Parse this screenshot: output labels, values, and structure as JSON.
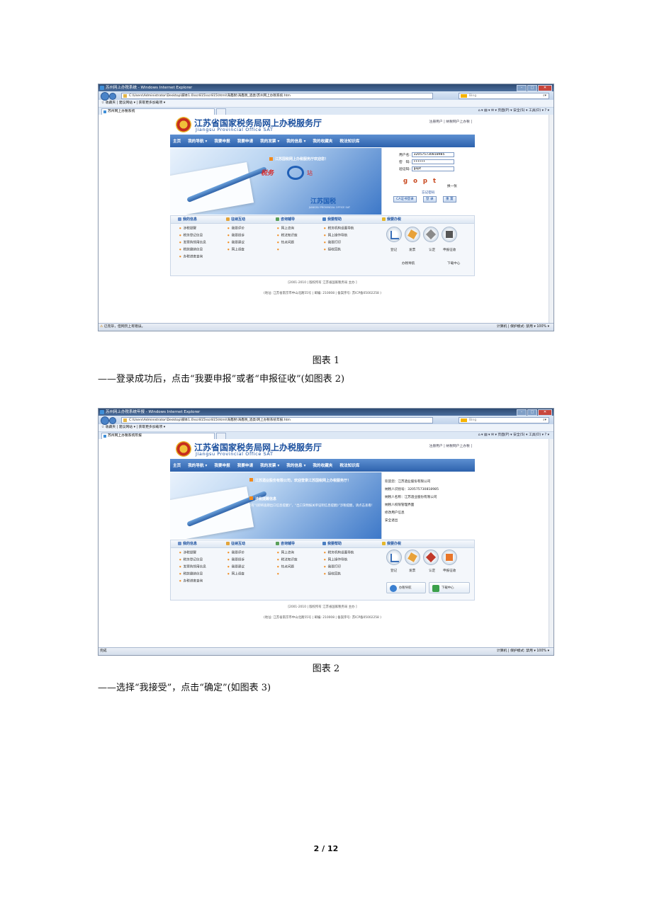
{
  "figure1": {
    "window_title": "苏州网上办税系统 - Windows Internet Explorer",
    "address": "C:\\Users\\Administrator\\Desktop\\脚本1.0\\scr815\\scr815\\html\\海鑫税\\海鑫税_酒类\\苏州网上办税系统.htm",
    "search_placeholder": "Bing",
    "fav_bar": "☆ 收藏夹  |  建议网站 ▾  |  获取更多加载项 ▾",
    "tab_title": "苏州网上办税系统",
    "command_bar": "⌂ ▾ ▤ ▾ ✉ ▾ 页面(P) ▾  安全(S) ▾  工具(O) ▾  ? ▾",
    "status_left": "已完毕，但网页上有错误。",
    "status_right": "计算机 | 保护模式: 禁用    ▾   100%  ▾",
    "login": {
      "username_label": "用户名:",
      "username_value": "320575730818985",
      "password_label": "密　码:",
      "password_value": "••••••",
      "verify_label": "验证码:",
      "verify_value": "gopt",
      "captcha_text": "gopt",
      "refresh": "换一张",
      "forgot": "忘记密码",
      "btn_ca": "CA证书登录",
      "btn_login": "登 录",
      "btn_reset": "重 置"
    },
    "banner_notice": "江苏国税网上办税服务厅欢迎您！"
  },
  "figure2": {
    "window_title": "苏州网上办税系统年报 - Windows Internet Explorer",
    "address": "C:\\Users\\Administrator\\Desktop\\脚本1.0\\scr815\\scr815\\html\\海鑫税\\海鑫税_酒类\\网上办税系统年报.htm",
    "search_placeholder": "Bing",
    "fav_bar": "☆ 收藏夹  |  建议网站 ▾  |  获取更多加载项 ▾",
    "tab_title": "苏州网上办税系统年报",
    "command_bar": "⌂ ▾ ▤ ▾ ✉ ▾ 页面(P) ▾  安全(S) ▾  工具(O) ▾  ? ▾",
    "status_left": "完成",
    "status_right": "计算机 | 保护模式: 禁用    ▾   100%  ▾",
    "banner_notice": "江苏酒业股份有限公司，欢迎登录江苏国税网上办税服务厅！",
    "remind_title": "涉税提醒信息",
    "remind_text": "您有“《即将逾期出口信息提醒》”，“出口货物报关单证明信息提醒》”涉税提醒，请点击查看！",
    "welcome": {
      "line1": "欢迎您：江苏酒业股份有限公司",
      "line2": "纳税人识别号：320575730818985",
      "line3": "纳税人名称：江苏酒业股份有限公司",
      "line4": "纳税人权限管理界面",
      "line5": "修改用户信息",
      "line6": "安全退出"
    },
    "btn_nav": "办税导航",
    "btn_download": "下载中心"
  },
  "site": {
    "brand_cn": "江苏省国家税务局网上办税服务厅",
    "brand_en": "Jiangsu Provincial Office SAT",
    "top_links": "注册用户 | 纳税网户上办税 |",
    "nav": [
      "主页",
      "我的导航 ▾",
      "我要申报",
      "我要申请",
      "我的发票 ▾",
      "我的信息 ▾",
      "我的收藏夹",
      "税法知识库"
    ],
    "banner_logo": "税务",
    "banner_station": "站",
    "banner_gs": "江苏国税",
    "banner_gs_sub": "JIANGSU PROVINCIAL OFFICE SAT",
    "categories": [
      "我的信息",
      "征纳互动",
      "咨询辅导",
      "我要帮助",
      "我要办税"
    ],
    "col1": [
      "涉税提醒",
      "税务登记信息",
      "发票购领用信息",
      "税款缴纳信息",
      "办税进度查询"
    ],
    "col2": [
      "我要评价",
      "我要投诉",
      "我要建议",
      "网上调查"
    ],
    "col3": [
      "网上咨询",
      "税法知识库",
      "热点问题",
      ""
    ],
    "col4": [
      "税务机构设置导航",
      "网上操作导航",
      "我要打印",
      "接收回执"
    ],
    "tools": [
      "登记",
      "发票",
      "认定",
      "申报征收"
    ],
    "tool_sub1": "办税导航",
    "tool_sub2": "下载中心",
    "footer1": "[2001-2010 | 版权所有  江苏省国家税务局  主办 ]",
    "footer2": "(地址: 江苏省南京市中山北路55号 | 邮编: 210008 | 备案序号: 苏ICP备05002258 )"
  },
  "doc": {
    "caption1": "图表 1",
    "instruction1": "——登录成功后，点击“我要申报”或者“申报征收”(如图表 2)",
    "caption2": "图表 2",
    "instruction2": "——选择“我接受”，点击“确定”(如图表 3)",
    "page_number": "2 / 12"
  }
}
